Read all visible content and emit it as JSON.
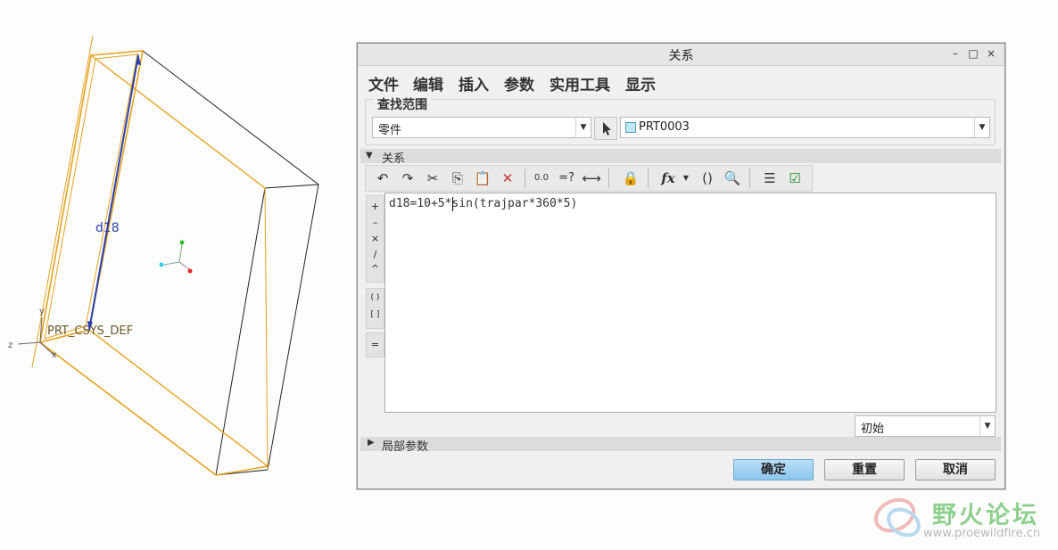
{
  "viewport": {
    "dimension_label": "d18",
    "csys_label": "PRT_CSYS_DEF",
    "axis_y": "y",
    "axis_z": "z",
    "axis_x": "x"
  },
  "dialog": {
    "title": "关系",
    "window_buttons": [
      "–",
      "□",
      "×"
    ],
    "menus": [
      "文件",
      "编辑",
      "插入",
      "参数",
      "实用工具",
      "显示"
    ],
    "scope": {
      "legend": "查找范围",
      "type_value": "零件",
      "object_value": "PRT0003"
    },
    "relations_section": "关系",
    "editor_text": "d18=10+5*sin(trajpar*360*5)",
    "operators": [
      "+",
      "–",
      "×",
      "/",
      "^",
      "( )",
      "[ ]",
      "="
    ],
    "unit_dropdown": "初始",
    "local_params_section": "局部参数",
    "buttons": {
      "ok": "确定",
      "reset": "重置",
      "cancel": "取消"
    }
  },
  "watermark": {
    "text": "野火论坛",
    "url": "www.proewildfire.cn"
  },
  "colors": {
    "edge_highlight": "#e6a21e",
    "dimension_blue": "#2c3fae",
    "primary_button": "#9fd2f1"
  }
}
